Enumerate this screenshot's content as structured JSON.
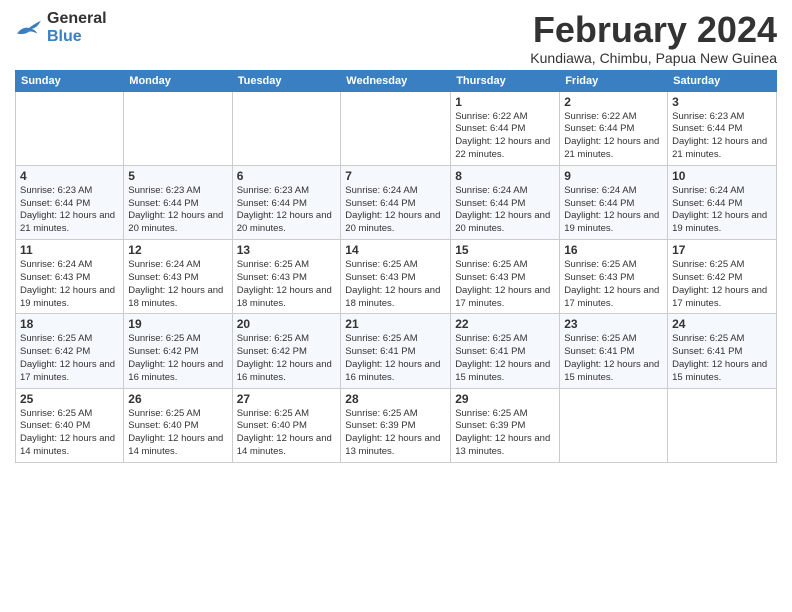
{
  "logo": {
    "line1": "General",
    "line2": "Blue"
  },
  "title": "February 2024",
  "subtitle": "Kundiawa, Chimbu, Papua New Guinea",
  "days_of_week": [
    "Sunday",
    "Monday",
    "Tuesday",
    "Wednesday",
    "Thursday",
    "Friday",
    "Saturday"
  ],
  "weeks": [
    [
      {
        "day": "",
        "info": ""
      },
      {
        "day": "",
        "info": ""
      },
      {
        "day": "",
        "info": ""
      },
      {
        "day": "",
        "info": ""
      },
      {
        "day": "1",
        "info": "Sunrise: 6:22 AM\nSunset: 6:44 PM\nDaylight: 12 hours\nand 22 minutes."
      },
      {
        "day": "2",
        "info": "Sunrise: 6:22 AM\nSunset: 6:44 PM\nDaylight: 12 hours\nand 21 minutes."
      },
      {
        "day": "3",
        "info": "Sunrise: 6:23 AM\nSunset: 6:44 PM\nDaylight: 12 hours\nand 21 minutes."
      }
    ],
    [
      {
        "day": "4",
        "info": "Sunrise: 6:23 AM\nSunset: 6:44 PM\nDaylight: 12 hours\nand 21 minutes."
      },
      {
        "day": "5",
        "info": "Sunrise: 6:23 AM\nSunset: 6:44 PM\nDaylight: 12 hours\nand 20 minutes."
      },
      {
        "day": "6",
        "info": "Sunrise: 6:23 AM\nSunset: 6:44 PM\nDaylight: 12 hours\nand 20 minutes."
      },
      {
        "day": "7",
        "info": "Sunrise: 6:24 AM\nSunset: 6:44 PM\nDaylight: 12 hours\nand 20 minutes."
      },
      {
        "day": "8",
        "info": "Sunrise: 6:24 AM\nSunset: 6:44 PM\nDaylight: 12 hours\nand 20 minutes."
      },
      {
        "day": "9",
        "info": "Sunrise: 6:24 AM\nSunset: 6:44 PM\nDaylight: 12 hours\nand 19 minutes."
      },
      {
        "day": "10",
        "info": "Sunrise: 6:24 AM\nSunset: 6:44 PM\nDaylight: 12 hours\nand 19 minutes."
      }
    ],
    [
      {
        "day": "11",
        "info": "Sunrise: 6:24 AM\nSunset: 6:43 PM\nDaylight: 12 hours\nand 19 minutes."
      },
      {
        "day": "12",
        "info": "Sunrise: 6:24 AM\nSunset: 6:43 PM\nDaylight: 12 hours\nand 18 minutes."
      },
      {
        "day": "13",
        "info": "Sunrise: 6:25 AM\nSunset: 6:43 PM\nDaylight: 12 hours\nand 18 minutes."
      },
      {
        "day": "14",
        "info": "Sunrise: 6:25 AM\nSunset: 6:43 PM\nDaylight: 12 hours\nand 18 minutes."
      },
      {
        "day": "15",
        "info": "Sunrise: 6:25 AM\nSunset: 6:43 PM\nDaylight: 12 hours\nand 17 minutes."
      },
      {
        "day": "16",
        "info": "Sunrise: 6:25 AM\nSunset: 6:43 PM\nDaylight: 12 hours\nand 17 minutes."
      },
      {
        "day": "17",
        "info": "Sunrise: 6:25 AM\nSunset: 6:42 PM\nDaylight: 12 hours\nand 17 minutes."
      }
    ],
    [
      {
        "day": "18",
        "info": "Sunrise: 6:25 AM\nSunset: 6:42 PM\nDaylight: 12 hours\nand 17 minutes."
      },
      {
        "day": "19",
        "info": "Sunrise: 6:25 AM\nSunset: 6:42 PM\nDaylight: 12 hours\nand 16 minutes."
      },
      {
        "day": "20",
        "info": "Sunrise: 6:25 AM\nSunset: 6:42 PM\nDaylight: 12 hours\nand 16 minutes."
      },
      {
        "day": "21",
        "info": "Sunrise: 6:25 AM\nSunset: 6:41 PM\nDaylight: 12 hours\nand 16 minutes."
      },
      {
        "day": "22",
        "info": "Sunrise: 6:25 AM\nSunset: 6:41 PM\nDaylight: 12 hours\nand 15 minutes."
      },
      {
        "day": "23",
        "info": "Sunrise: 6:25 AM\nSunset: 6:41 PM\nDaylight: 12 hours\nand 15 minutes."
      },
      {
        "day": "24",
        "info": "Sunrise: 6:25 AM\nSunset: 6:41 PM\nDaylight: 12 hours\nand 15 minutes."
      }
    ],
    [
      {
        "day": "25",
        "info": "Sunrise: 6:25 AM\nSunset: 6:40 PM\nDaylight: 12 hours\nand 14 minutes."
      },
      {
        "day": "26",
        "info": "Sunrise: 6:25 AM\nSunset: 6:40 PM\nDaylight: 12 hours\nand 14 minutes."
      },
      {
        "day": "27",
        "info": "Sunrise: 6:25 AM\nSunset: 6:40 PM\nDaylight: 12 hours\nand 14 minutes."
      },
      {
        "day": "28",
        "info": "Sunrise: 6:25 AM\nSunset: 6:39 PM\nDaylight: 12 hours\nand 13 minutes."
      },
      {
        "day": "29",
        "info": "Sunrise: 6:25 AM\nSunset: 6:39 PM\nDaylight: 12 hours\nand 13 minutes."
      },
      {
        "day": "",
        "info": ""
      },
      {
        "day": "",
        "info": ""
      }
    ]
  ]
}
